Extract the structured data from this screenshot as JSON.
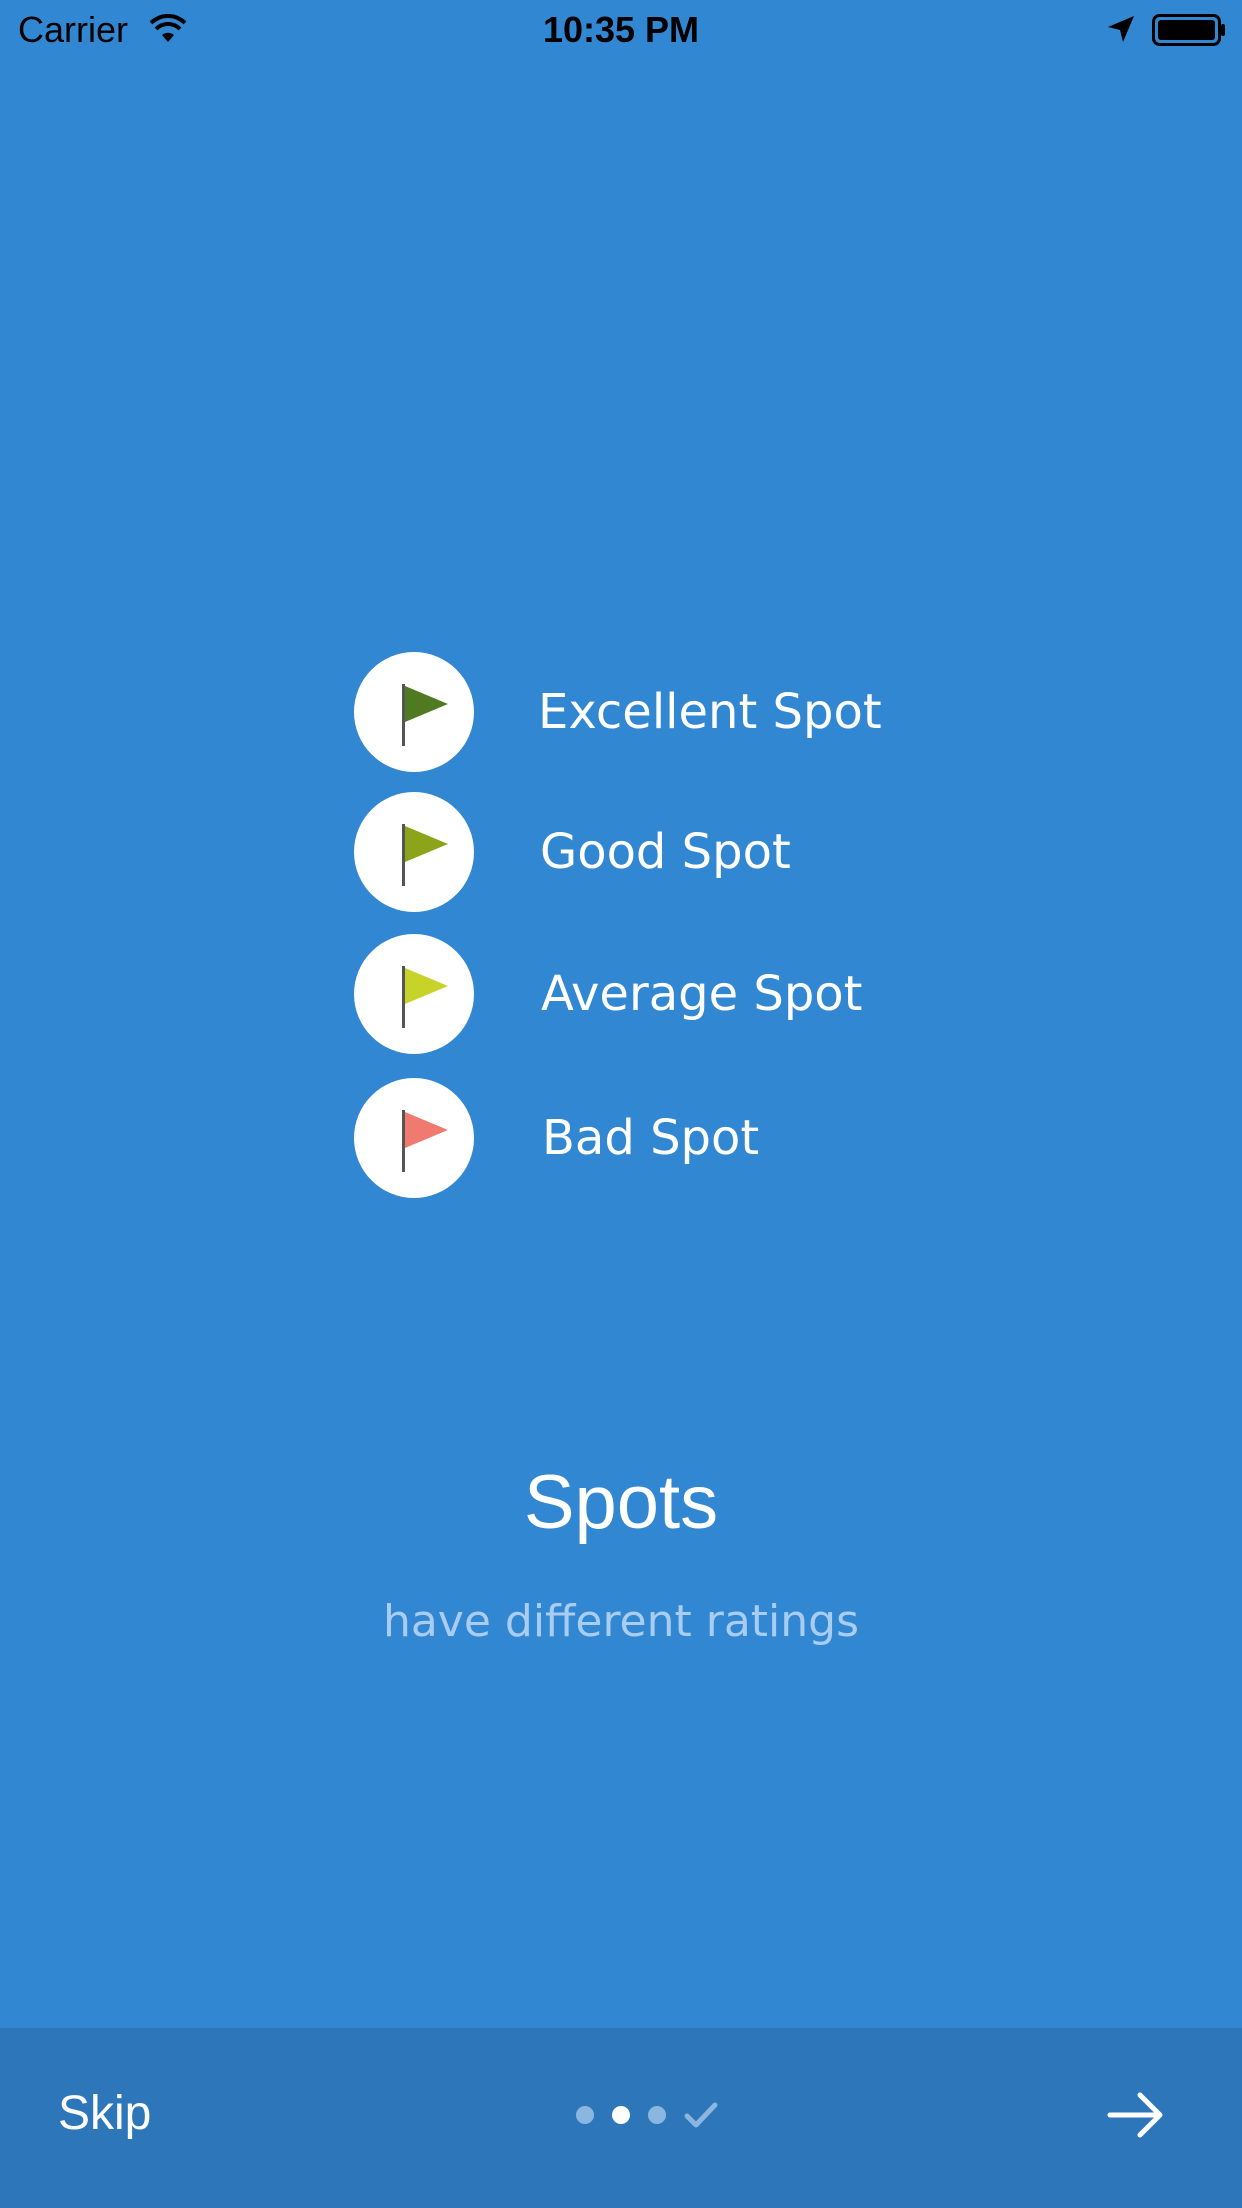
{
  "status_bar": {
    "carrier": "Carrier",
    "time": "10:35 PM",
    "icons": [
      "wifi-icon",
      "location-arrow-icon",
      "battery-icon"
    ]
  },
  "ratings": [
    {
      "label": "Excellent Spot",
      "flag_color": "#4f7a22",
      "icon": "flag-icon"
    },
    {
      "label": "Good Spot",
      "flag_color": "#8ba41a",
      "icon": "flag-icon"
    },
    {
      "label": "Average Spot",
      "flag_color": "#c8d32a",
      "icon": "flag-icon"
    },
    {
      "label": "Bad Spot",
      "flag_color": "#f07a70",
      "icon": "flag-icon"
    }
  ],
  "content": {
    "title": "Spots",
    "subtitle": "have different ratings"
  },
  "footer": {
    "skip_label": "Skip",
    "pager": {
      "total_pages": 4,
      "current_page": 2,
      "last_page_icon": "checkmark-icon"
    },
    "next_icon": "arrow-right-icon"
  },
  "colors": {
    "background": "#3287d3",
    "footer_background": "#2d76b9",
    "subtitle": "#a9cdf0",
    "dot_inactive": "#8bb6e0",
    "dot_active": "#ffffff"
  }
}
